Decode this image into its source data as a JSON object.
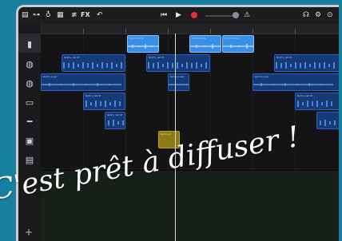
{
  "toolbar": {
    "fx_label": "FX"
  },
  "track_icons": [
    "track-view-icon",
    "drum-kit-icon",
    "drummer-icon",
    "keyboard-icon",
    "guitar-icon",
    "amp-icon",
    "drum-machine-icon"
  ],
  "region_labels": {
    "top_a": "Ryhm Daire",
    "top_b": "Ryhm Daire",
    "top_c": "Ryhm Daire",
    "drum_a": "Ryhm_cell 0f",
    "drum_b": "Ryhm_cell 0f",
    "drum_c": "Ryhm_cell 0f",
    "drum_d": "Ryhm_cell 0f",
    "perc_a": "Ryhm_Loop",
    "perc_b": "Ryhm_Loop",
    "perc_c": "Ryhm_Loop",
    "key_a": "Ryhm_cell 0f",
    "key_b": "Ryhm_cell 0f",
    "key_c": "Ryhm_cell 0f",
    "yellow": "Ryhm_Ar"
  },
  "overlay": {
    "caption": "C'est prêt à diffuser !"
  },
  "colors": {
    "background": "#17809e",
    "region_dark": "#143a78",
    "region_light": "#3a8fe8",
    "region_yellow": "#8c7a12",
    "record": "#e8303a"
  }
}
